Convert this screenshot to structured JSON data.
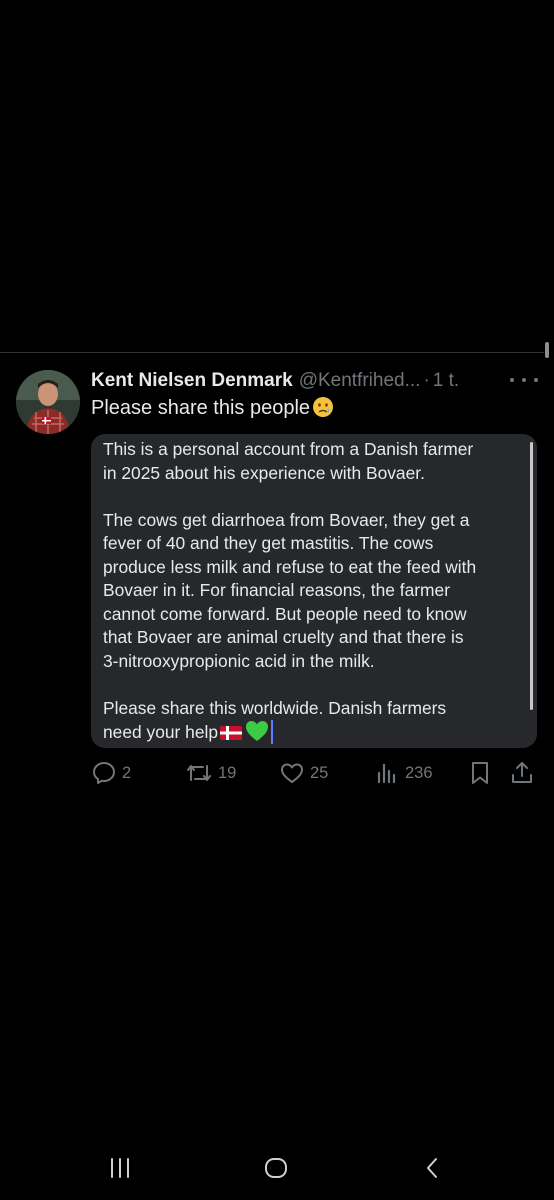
{
  "tweet": {
    "display_name": "Kent Nielsen Denmark",
    "handle": "@Kentfrihed...",
    "separator": "·",
    "timestamp": "1 t.",
    "text": "Please share this people",
    "text_emoji": "crying-face-emoji"
  },
  "quote": {
    "paragraph_1": "This is a personal account from a Danish farmer\nin 2025 about his experience with Bovaer.",
    "paragraph_2": "The cows get diarrhoea from Bovaer, they get a\nfever of 40 and they get mastitis. The cows\nproduce less milk and refuse to eat the feed with\nBovaer in it. For financial reasons, the farmer\ncannot come forward. But people need to know\nthat Bovaer are animal cruelty and that there is\n3-nitrooxypropionic acid in the milk.",
    "paragraph_3_line_1": "Please share this worldwide. Danish farmers",
    "paragraph_3_line_2": "need your help",
    "trailing_emojis": [
      "denmark-flag-emoji",
      "green-heart-emoji"
    ]
  },
  "actions": {
    "replies": "2",
    "reposts": "19",
    "likes": "25",
    "views": "236"
  },
  "icons": {
    "reply": "reply-icon",
    "repost": "repost-icon",
    "like": "heart-icon",
    "views": "views-icon",
    "bookmark": "bookmark-icon",
    "share": "share-icon",
    "more": "more-icon",
    "recents": "recents-icon",
    "home": "home-icon",
    "back": "back-icon"
  },
  "colors": {
    "background": "#000000",
    "text": "#e7e9ea",
    "muted": "#71767b",
    "quote_background": "#26282b",
    "divider": "#2f3336",
    "flag_red": "#c8102e",
    "heart_green": "#3ccb42",
    "cursor": "#5b7cff"
  }
}
